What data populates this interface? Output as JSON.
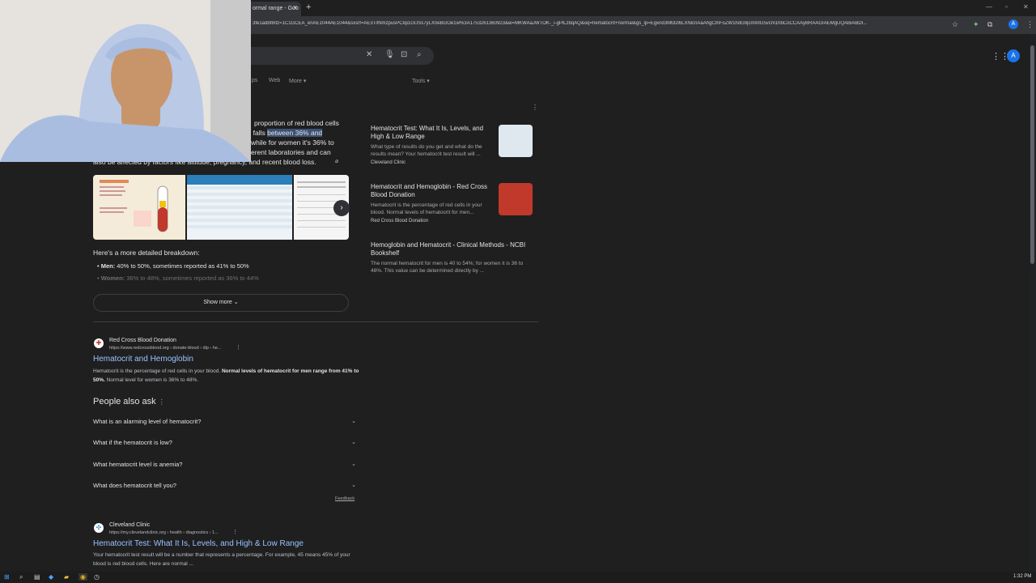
{
  "browser": {
    "tab_title": "ormal range - Goo",
    "tab_close": "×",
    "tab_new": "+",
    "url": "3fe1adbf8rlz=1C1GCEA_enAE1044AE1044&sxsrf=AE3TifNmzpusPCIqi1GUSs7yLX0eBGOe1w%3A1753261360923&ei=MKWAaJWTOK-_i-gPlLzbqAQ&oq=hematocrit+normal&gs_lp=Egxnd3Mtd2l6LXNlcnAaAhgCIhFoZW1hdG9jcml0IG5vcm1hbCoCCAAyBRAAGIAEMgUQABiABDI..."
  },
  "search": {
    "tabs": [
      "ps",
      "Web",
      "More ▾"
    ],
    "tools": "Tools ▾"
  },
  "account": {
    "initial": "A"
  },
  "overview": {
    "lines": [
      "proportion of red blood cells",
      "y falls ",
      "between 36% and",
      "while for women it's 36% to",
      "erent laboratories and can",
      "also be affected by factors like altitude, pregnancy, and recent blood loss."
    ],
    "breakdown_heading": "Here's a more detailed breakdown:",
    "bullets": [
      {
        "label": "Men:",
        "text": " 40% to 50%, sometimes reported as 41% to 50%"
      },
      {
        "label": "Women:",
        "text": " 36% to 48%, sometimes reported as 36% to 44%"
      }
    ],
    "show_more": "Show more"
  },
  "source_cards": [
    {
      "title": "Hematocrit Test: What It Is, Levels, and High & Low Range",
      "snippet": "What type of results do you get and what do the results mean? Your hematocrit test result will ...",
      "source": "Cleveland Clinic"
    },
    {
      "title": "Hematocrit and Hemoglobin - Red Cross Blood Donation",
      "snippet": "Hematocrit is the percentage of red cells in your blood. Normal levels of hematocrit for men...",
      "source": "Red Cross Blood Donation"
    },
    {
      "title": "Hemoglobin and Hematocrit - Clinical Methods - NCBI Bookshelf",
      "snippet": "The normal hematocrit for men is 40 to 54%; for women it is 36 to 48%. This value can be determined directly by ...",
      "source": ""
    }
  ],
  "results": [
    {
      "site_name": "Red Cross Blood Donation",
      "site_url": "https://www.redcrossblood.org › donate-blood › dlp › he...",
      "title": "Hematocrit and Hemoglobin",
      "snippet_plain": "Hematocrit is the percentage of red cells in your blood. ",
      "snippet_bold": "Normal levels of hematocrit for men range from 41% to 50%.",
      "snippet_end": " Normal level for women is 36% to 48%."
    },
    {
      "site_name": "Cleveland Clinic",
      "site_url": "https://my.clevelandclinic.org › health › diagnostics › 1...",
      "title": "Hematocrit Test: What It Is, Levels, and High & Low Range",
      "snippet_plain": "Your hematocrit test result will be a number that represents a percentage. For example, 45 means 45% of your blood is red blood cells. Here are normal ..."
    }
  ],
  "paa": {
    "heading": "People also ask",
    "questions": [
      "What is an alarming level of hematocrit?",
      "What if the hematocrit is low?",
      "What hematocrit level is anemia?",
      "What does hematocrit tell you?"
    ],
    "feedback": "Feedback"
  },
  "taskbar": {
    "clock": "1:32 PM"
  },
  "colors": {
    "link": "#99c3ff",
    "highlight": "#3d5274",
    "bg": "#1f1f1f"
  }
}
